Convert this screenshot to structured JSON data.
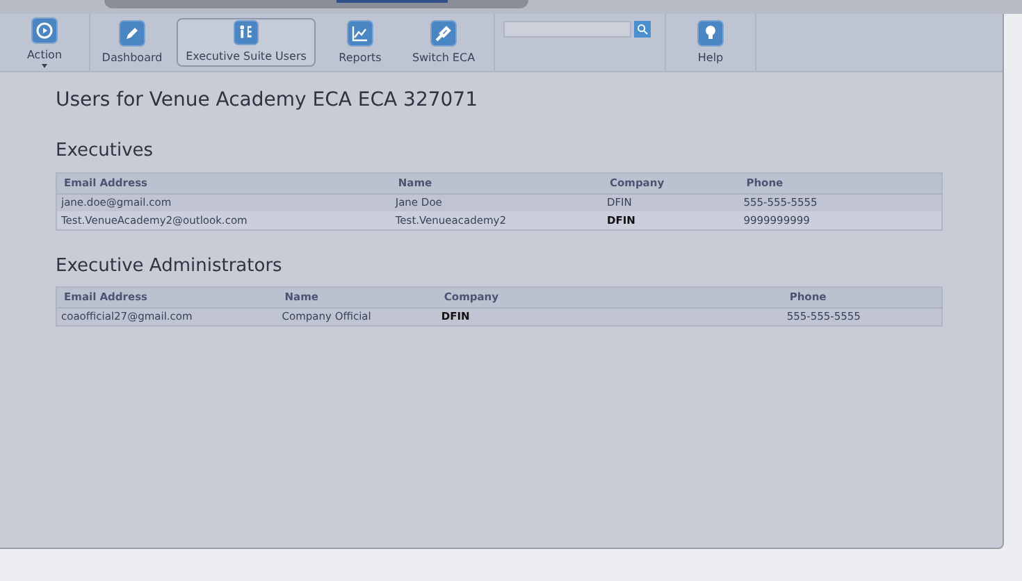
{
  "toolbar": {
    "items": [
      {
        "label": "Action",
        "selected": false,
        "has_menu": true
      },
      {
        "label": "Dashboard",
        "selected": false,
        "has_menu": false
      },
      {
        "label": "Executive Suite Users",
        "selected": true,
        "has_menu": false
      },
      {
        "label": "Reports",
        "selected": false,
        "has_menu": false
      },
      {
        "label": "Switch ECA",
        "selected": false,
        "has_menu": false
      }
    ],
    "help": {
      "label": "Help"
    }
  },
  "page_title": "Users for Venue Academy ECA ECA 327071",
  "sections": [
    {
      "title": "Executives",
      "columns": [
        "Email Address",
        "Name",
        "Company",
        "Phone"
      ],
      "rows": [
        {
          "cells": [
            "jane.doe@gmail.com",
            "Jane Doe",
            "DFIN",
            "555-555-5555"
          ],
          "company_bold": false
        },
        {
          "cells": [
            "Test.VenueAcademy2@outlook.com",
            "Test.Venueacademy2",
            "DFIN",
            "9999999999"
          ],
          "company_bold": true
        }
      ]
    },
    {
      "title": "Executive Administrators",
      "columns": [
        "Email Address",
        "Name",
        "Company",
        "Phone"
      ],
      "rows": [
        {
          "cells": [
            "coaofficial27@gmail.com",
            "Company Official",
            "DFIN",
            "555-555-5555"
          ],
          "company_bold": true
        }
      ]
    }
  ]
}
